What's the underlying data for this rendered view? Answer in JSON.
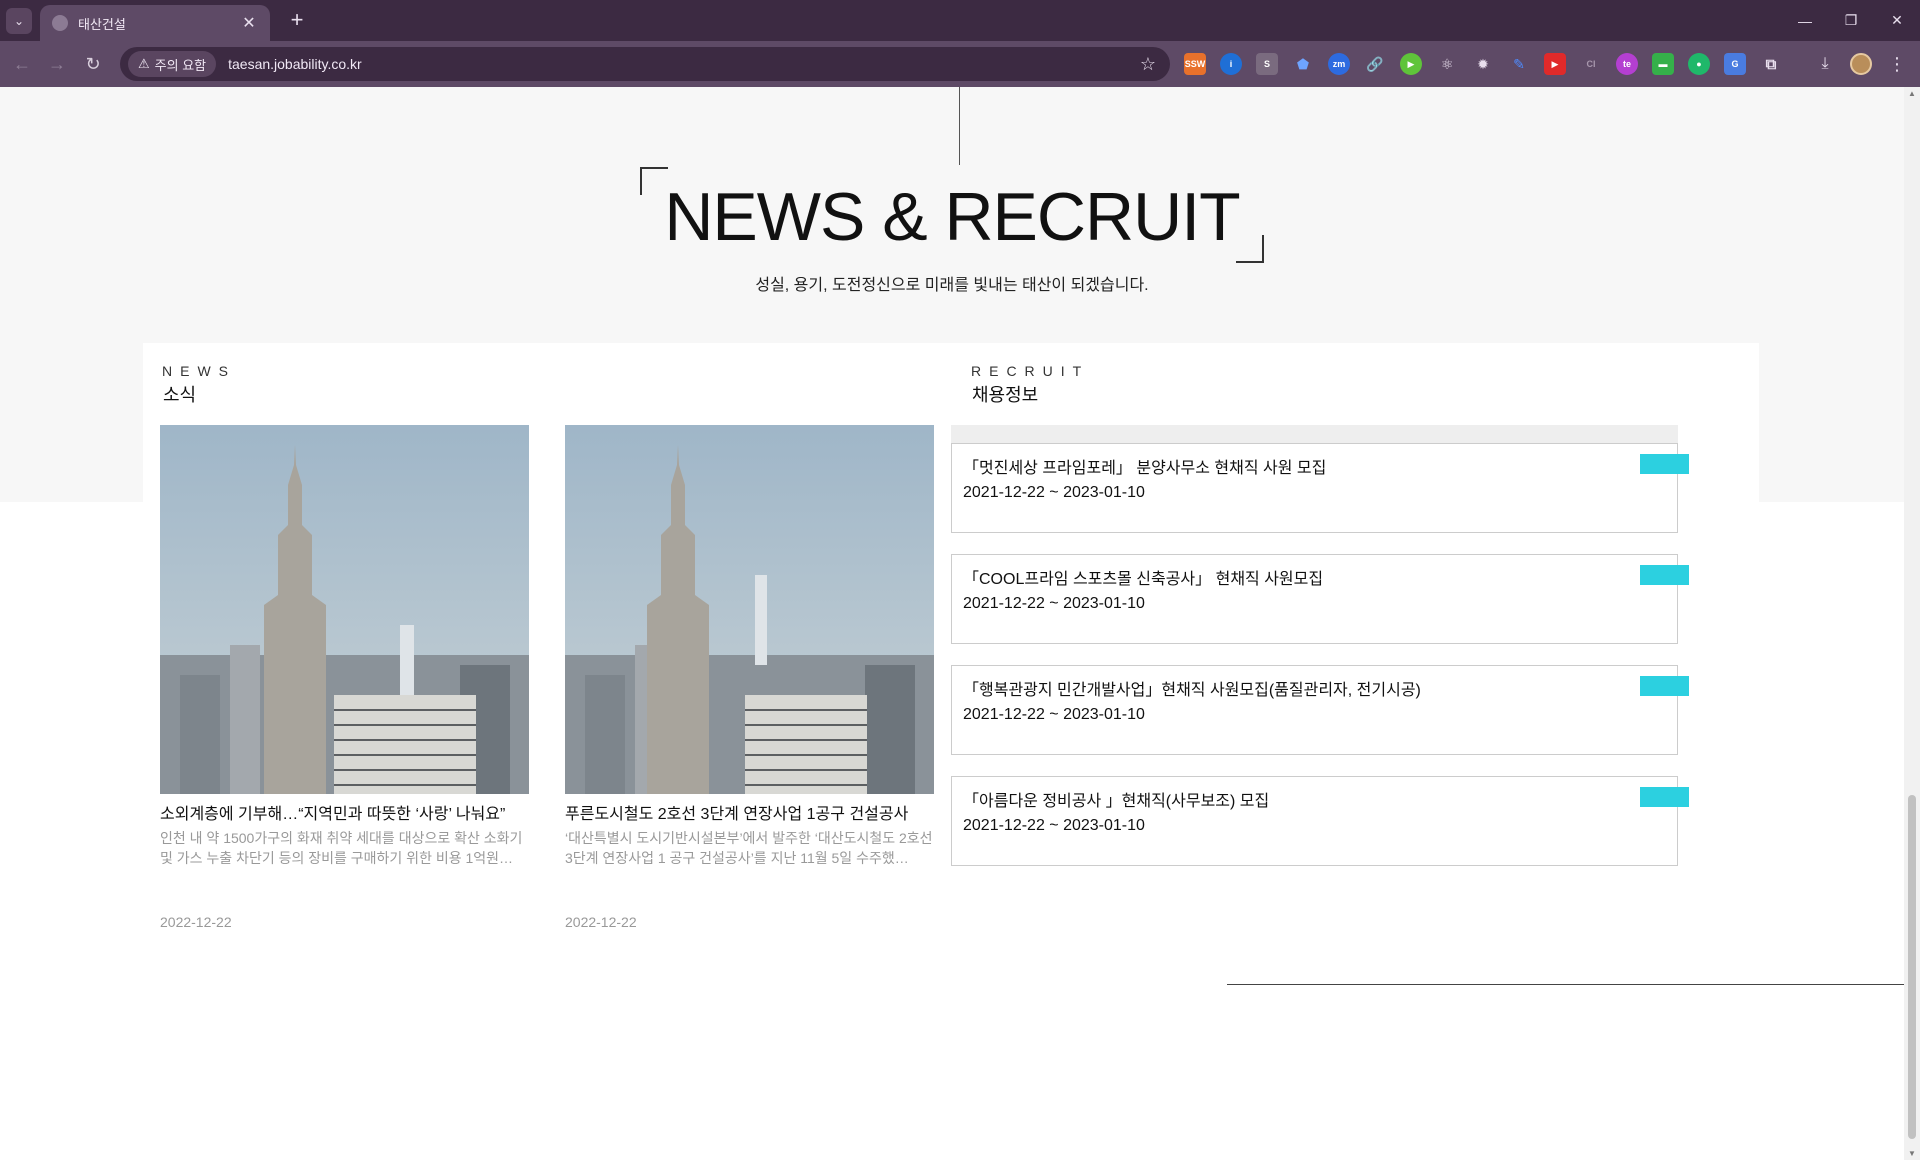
{
  "browser": {
    "tab_title": "태산건설",
    "security_label": "주의 요함",
    "url": "taesan.jobability.co.kr",
    "extensions": [
      "ssw-ext",
      "info-ext",
      "s-ext",
      "shield-ext",
      "zoom-ext",
      "link-ext",
      "play-ext",
      "react-ext",
      "gear-ext",
      "pen-ext",
      "youtube-ext",
      "ci-ext",
      "te-ext",
      "card-ext",
      "chat-ext",
      "translate-ext",
      "puzzle-ext"
    ],
    "extension_labels": {
      "ssw": "SSW",
      "zoom": "zm",
      "ci": "CI",
      "te": "te"
    }
  },
  "page": {
    "heading": "NEWS & RECRUIT",
    "subtitle": "성실, 용기, 도전정신으로 미래를 빛내는 태산이 되겠습니다.",
    "news_section": {
      "en": "NEWS",
      "ko": "소식"
    },
    "recruit_section": {
      "en": "RECRUIT",
      "ko": "채용정보"
    },
    "news": [
      {
        "title": "소외계층에 기부해…“지역민과 따뜻한 ‘사랑’ 나눠요”",
        "desc": "인천 내 약 1500가구의 화재 취약 세대를 대상으로 확산 소화기 및 가스 누출 차단기 등의 장비를 구매하기 위한 비용 1억원…",
        "date": "2022-12-22"
      },
      {
        "title": "푸른도시철도 2호선 3단계 연장사업 1공구 건설공사",
        "desc": "‘대산특별시 도시기반시설본부’에서 발주한 ‘대산도시철도 2호선 3단계 연장사업 1 공구 건설공사’를 지난 11월 5일 수주했…",
        "date": "2022-12-22"
      }
    ],
    "recruit": [
      {
        "title": "「멋진세상 프라임포레」 분양사무소 현채직 사원 모집",
        "date": "2021-12-22 ~ 2023-01-10"
      },
      {
        "title": "「COOL프라임 스포츠몰 신축공사」 현채직 사원모집",
        "date": "2021-12-22 ~ 2023-01-10"
      },
      {
        "title": "「행복관광지 민간개발사업」현채직 사원모집(품질관리자, 전기시공)",
        "date": "2021-12-22 ~ 2023-01-10"
      },
      {
        "title": "「아름다운 정비공사 」현채직(사무보조) 모집",
        "date": "2021-12-22 ~ 2023-01-10"
      }
    ]
  },
  "colors": {
    "chrome_dark": "#3c2a42",
    "chrome_toolbar": "#5e4a66",
    "accent_badge": "#2cd0e0",
    "band": "#f7f7f7"
  }
}
